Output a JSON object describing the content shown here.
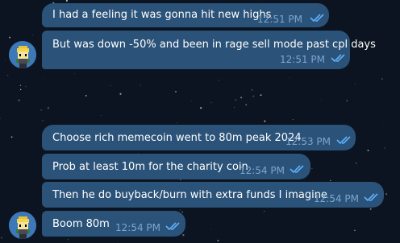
{
  "messages": [
    {
      "text": "I had a feeling it was gonna hit new highs",
      "time": "12:51 PM",
      "status": "read"
    },
    {
      "text": "But was down -50% and been in rage sell mode past cpl days",
      "time": "12:51 PM",
      "status": "read"
    },
    {
      "text": "Choose rich memecoin went to 80m peak 2024",
      "time": "12:53 PM",
      "status": "read"
    },
    {
      "text": "Prob at least 10m for the charity coin",
      "time": "12:54 PM",
      "status": "read"
    },
    {
      "text": "Then he do buyback/burn with extra funds I imagine",
      "time": "12:54 PM",
      "status": "read"
    },
    {
      "text": "Boom 80m",
      "time": "12:54 PM",
      "status": "read"
    }
  ],
  "avatar_icon": "pixel-character-avatar-icon",
  "read_icon": "double-check-icon",
  "colors": {
    "bubble": "#2b5278",
    "time": "#7da6cf",
    "checks": "#5fb2ff",
    "background": "#0b1420"
  }
}
